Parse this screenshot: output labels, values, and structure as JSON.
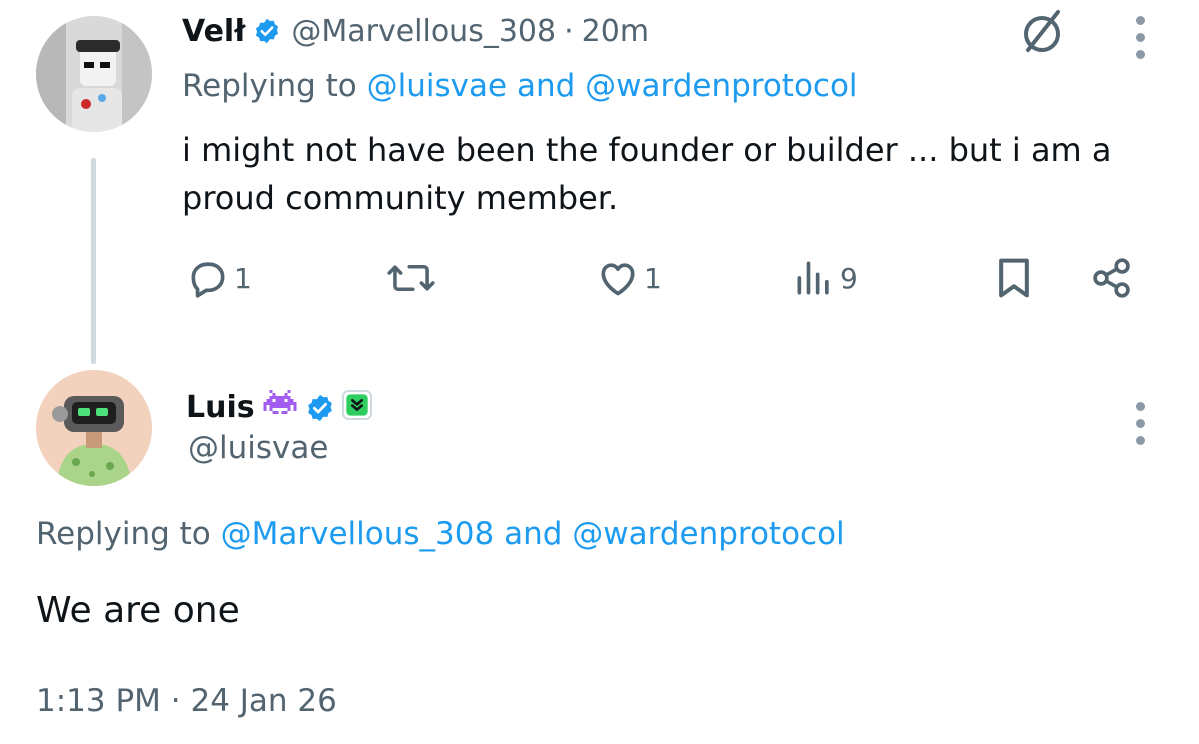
{
  "tweet1": {
    "display_name": "Velł",
    "handle": "@Marvellous_308",
    "separator": "·",
    "time": "20m",
    "replying_prefix": "Replying to",
    "replying_to_1": "@luisvae",
    "replying_and": "and",
    "replying_to_2": "@wardenprotocol",
    "text": "i might not have been the founder or builder ... but i am a proud community member.",
    "actions": {
      "reply_count": "1",
      "retweet_count": "",
      "like_count": "1",
      "views_count": "9"
    },
    "icons": [
      "verified-badge-icon",
      "grok-icon",
      "more-options-icon",
      "reply-icon",
      "retweet-icon",
      "like-icon",
      "views-icon",
      "bookmark-icon",
      "share-icon"
    ]
  },
  "tweet2": {
    "display_name": "Luis",
    "handle": "@luisvae",
    "replying_prefix": "Replying to",
    "replying_to_1": "@Marvellous_308",
    "replying_and": "and",
    "replying_to_2": "@wardenprotocol",
    "text": "We are one",
    "timestamp": "1:13 PM · 24 Jan 26",
    "icons": [
      "alien-emoji-icon",
      "verified-badge-icon",
      "affiliate-badge-icon",
      "more-options-icon"
    ]
  },
  "colors": {
    "text_primary": "#0f1419",
    "text_secondary": "#536471",
    "accent": "#1d9bf0",
    "thread_line": "#cfd9de",
    "emoji_purple": "#a35cf0",
    "affiliate_green": "#2dce5f"
  }
}
